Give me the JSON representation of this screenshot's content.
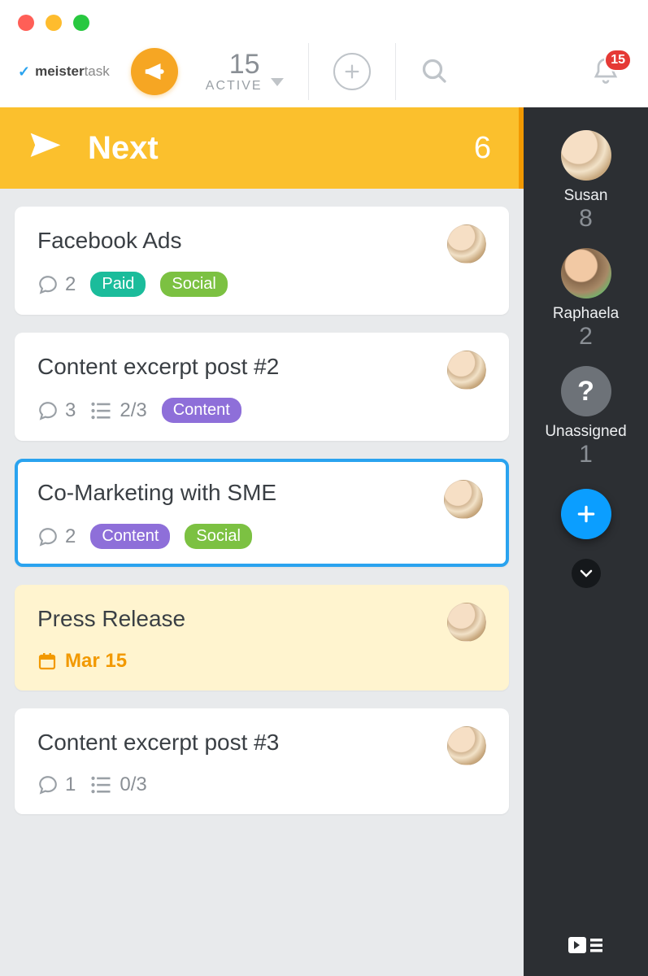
{
  "brand": {
    "name_bold": "meister",
    "name_thin": "task"
  },
  "active": {
    "count": "15",
    "label": "ACTIVE"
  },
  "notifications": {
    "count": "15"
  },
  "section": {
    "title": "Next",
    "count": "6"
  },
  "tags": {
    "paid": "Paid",
    "social": "Social",
    "content": "Content"
  },
  "tasks": [
    {
      "title": "Facebook Ads",
      "comments": "2",
      "tags": [
        "paid",
        "social"
      ]
    },
    {
      "title": "Content excerpt post #2",
      "comments": "3",
      "checklist": "2/3",
      "tags": [
        "content"
      ]
    },
    {
      "title": "Co-Marketing with SME",
      "comments": "2",
      "tags": [
        "content",
        "social"
      ],
      "selected": true
    },
    {
      "title": "Press Release",
      "due": "Mar 15",
      "highlight": true
    },
    {
      "title": "Content excerpt post #3",
      "comments": "1",
      "checklist": "0/3"
    }
  ],
  "people": [
    {
      "name": "Susan",
      "count": "8",
      "kind": "susan"
    },
    {
      "name": "Raphaela",
      "count": "2",
      "kind": "raph"
    },
    {
      "name": "Unassigned",
      "count": "1",
      "kind": "unassigned"
    }
  ]
}
